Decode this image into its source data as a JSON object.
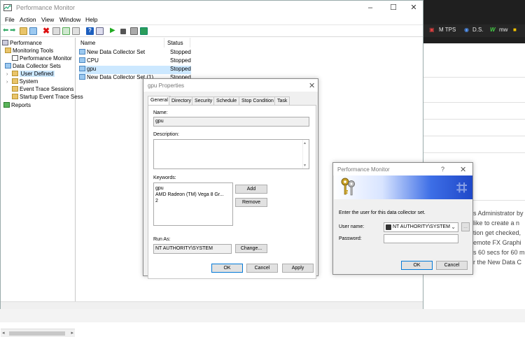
{
  "window": {
    "title": "Performance Monitor",
    "controls": [
      "–",
      "☐",
      "✕"
    ]
  },
  "menu": [
    "File",
    "Action",
    "View",
    "Window",
    "Help"
  ],
  "tree": [
    {
      "label": "Performance",
      "level": 0
    },
    {
      "label": "Monitoring Tools",
      "level": 1
    },
    {
      "label": "Performance Monitor",
      "level": 2
    },
    {
      "label": "Data Collector Sets",
      "level": 1
    },
    {
      "label": "User Defined",
      "level": 2,
      "selected": true
    },
    {
      "label": "System",
      "level": 2
    },
    {
      "label": "Event Trace Sessions",
      "level": 2
    },
    {
      "label": "Startup Event Trace Sess",
      "level": 2
    },
    {
      "label": "Reports",
      "level": 1
    }
  ],
  "list": {
    "columns": [
      "Name",
      "Status"
    ],
    "rows": [
      {
        "name": "New Data Collector Set",
        "status": "Stopped"
      },
      {
        "name": "CPU",
        "status": "Stopped"
      },
      {
        "name": "gpu",
        "status": "Stopped",
        "selected": true
      },
      {
        "name": "New Data Collector Set (1)",
        "status": "Stopped"
      }
    ]
  },
  "gpu_dialog": {
    "title": "gpu Properties",
    "close": "✕",
    "tabs": [
      "General",
      "Directory",
      "Security",
      "Schedule",
      "Stop Condition",
      "Task"
    ],
    "name_label": "Name:",
    "name_value": "gpu",
    "description_label": "Description:",
    "keywords_label": "Keywords:",
    "keywords": [
      "gpu",
      "AMD Radeon (TM) Vega 8 Gr...",
      "2"
    ],
    "add_label": "Add",
    "remove_label": "Remove",
    "run_as_label": "Run As:",
    "run_as_value": "NT AUTHORITY\\SYSTEM",
    "change_label": "Change...",
    "ok_label": "OK",
    "cancel_label": "Cancel",
    "apply_label": "Apply"
  },
  "user_dialog": {
    "title": "Performance Monitor",
    "help": "?",
    "close": "✕",
    "prompt": "Enter the user for this data collector set.",
    "user_label": "User name:",
    "user_value": "NT AUTHORITY\\SYSTEM",
    "browse_label": "...",
    "password_label": "Password:",
    "password_value": "",
    "ok_label": "OK",
    "cancel_label": "Cancel"
  },
  "background": {
    "tabs": [
      "M TPS",
      "D.S.",
      "mw"
    ],
    "text_lines": [
      "s Administrator by",
      "like to create a n",
      "tion get checked,",
      "emote FX Graphi",
      "s 60 secs for 60 m",
      "r the New Data C"
    ]
  },
  "colors": {
    "selection": "#cce8ff",
    "accent": "#0078d7",
    "banner_blue": "#1f48c8"
  }
}
